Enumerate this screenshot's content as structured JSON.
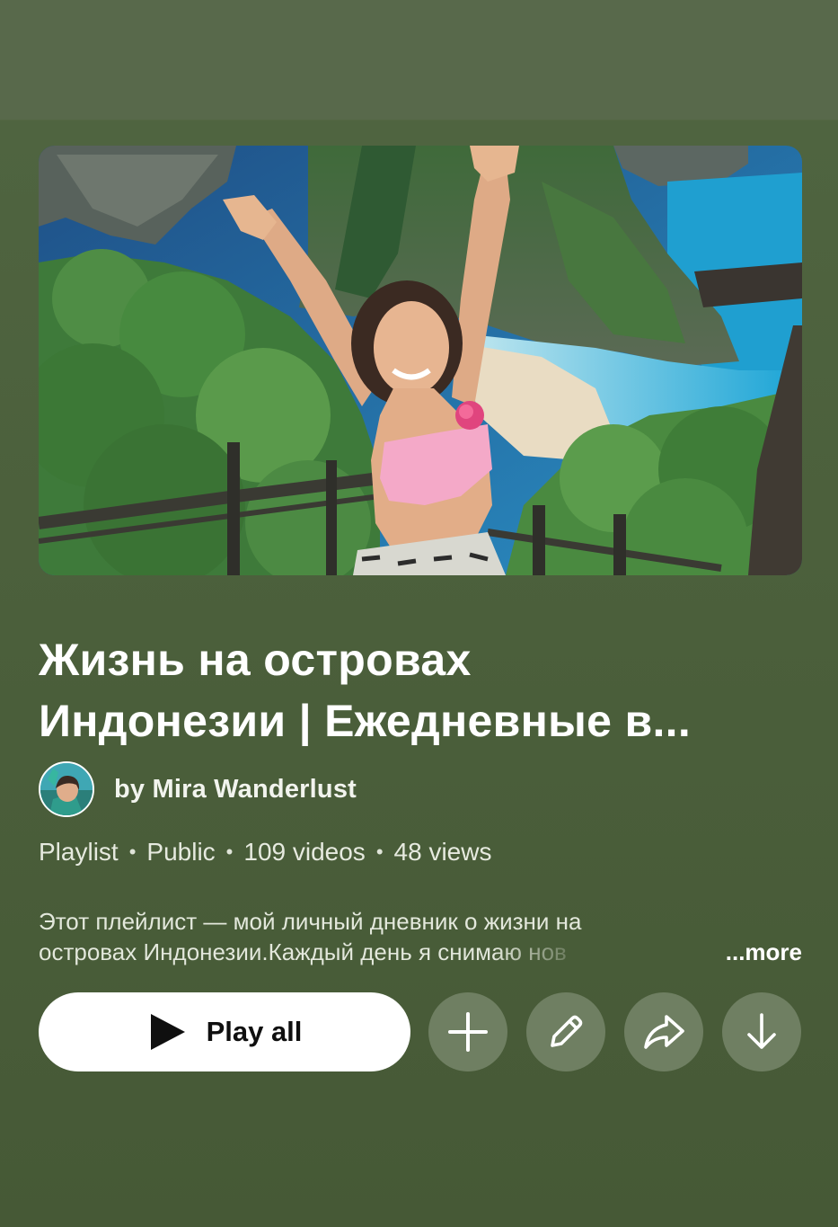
{
  "playlist": {
    "title_line1": "Жизнь на островах",
    "title_line2": "Индонезии | Ежедневные в...",
    "owner": "by Mira Wanderlust",
    "meta": {
      "type": "Playlist",
      "privacy": "Public",
      "videos": "109 videos",
      "views": "48 views"
    },
    "description_line1": "Этот плейлист — мой личный дневник о жизни на",
    "description_line2": "островах Индонезии.Каждый день я снимаю нов",
    "more_label": "...more"
  },
  "actions": {
    "play_all_label": "Play all",
    "add_icon": "plus-icon",
    "edit_icon": "pencil-icon",
    "share_icon": "share-arrow-icon",
    "download_icon": "download-arrow-icon"
  },
  "thumbnail": {
    "edit_icon": "pencil-icon"
  },
  "colors": {
    "background": "#4b5f3b",
    "circle_button": "#6f7f62",
    "primary_button": "#ffffff"
  }
}
